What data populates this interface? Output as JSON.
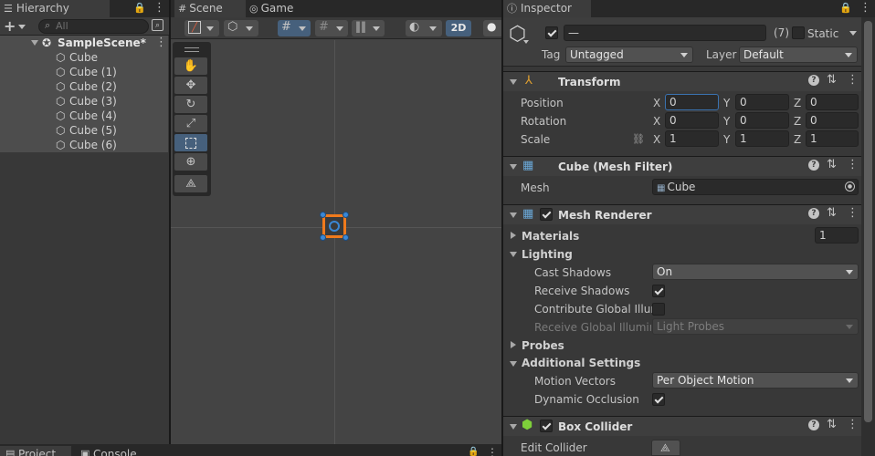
{
  "hierarchy": {
    "tab_label": "Hierarchy",
    "search_placeholder": "All",
    "scene_name": "SampleScene*",
    "items": [
      "Cube",
      "Cube (1)",
      "Cube (2)",
      "Cube (3)",
      "Cube (4)",
      "Cube (5)",
      "Cube (6)"
    ]
  },
  "scene_view": {
    "tabs": [
      "Scene",
      "Game"
    ],
    "toggle_2d": "2D",
    "tools": [
      "hand-tool",
      "move-tool",
      "rotate-tool",
      "scale-tool",
      "rect-tool",
      "transform-tool",
      "custom-tool"
    ],
    "active_tool": "rect-tool"
  },
  "bottom": {
    "tabs": [
      "Project",
      "Console"
    ]
  },
  "inspector": {
    "tab_label": "Inspector",
    "object_name": "—",
    "object_count": "(7)",
    "static_label": "Static",
    "tag_label": "Tag",
    "tag_value": "Untagged",
    "layer_label": "Layer",
    "layer_value": "Default",
    "transform": {
      "title": "Transform",
      "position_label": "Position",
      "rotation_label": "Rotation",
      "scale_label": "Scale",
      "axis_x": "X",
      "axis_y": "Y",
      "axis_z": "Z",
      "position": [
        "0",
        "0",
        "0"
      ],
      "rotation": [
        "0",
        "0",
        "0"
      ],
      "scale": [
        "1",
        "1",
        "1"
      ]
    },
    "mesh_filter": {
      "title": "Cube (Mesh Filter)",
      "mesh_label": "Mesh",
      "mesh_value": "Cube"
    },
    "mesh_renderer": {
      "title": "Mesh Renderer",
      "materials_label": "Materials",
      "materials_count": "1",
      "lighting_label": "Lighting",
      "cast_shadows_label": "Cast Shadows",
      "cast_shadows_value": "On",
      "receive_shadows_label": "Receive Shadows",
      "contribute_gi_label": "Contribute Global Illum",
      "receive_gi_label": "Receive Global Illumina",
      "receive_gi_value": "Light Probes",
      "probes_label": "Probes",
      "additional_label": "Additional Settings",
      "motion_vectors_label": "Motion Vectors",
      "motion_vectors_value": "Per Object Motion",
      "dynamic_occlusion_label": "Dynamic Occlusion"
    },
    "box_collider": {
      "title": "Box Collider",
      "edit_collider_label": "Edit Collider"
    }
  },
  "colors": {
    "panel_bg": "#383838",
    "header_bg": "#3e3e3e",
    "accent_blue": "#3a72b0",
    "selection_orange": "#f07a1c"
  }
}
